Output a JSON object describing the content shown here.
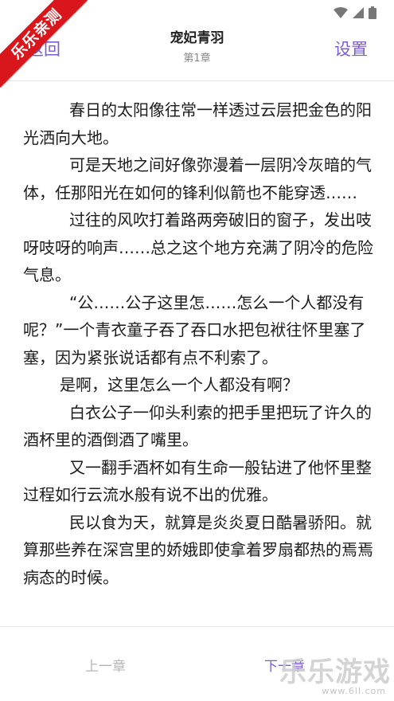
{
  "header": {
    "back_label": "返回",
    "book_title": "宠妃青羽",
    "chapter": "第1章",
    "settings_label": "设置"
  },
  "ribbon_text": "乐乐亲测",
  "content": {
    "paragraphs": [
      "春日的太阳像往常一样透过云层把金色的阳光洒向大地。",
      "可是天地之间好像弥漫着一层阴冷灰暗的气体，任那阳光在如何的锋利似箭也不能穿透……",
      "过往的风吹打着路两旁破旧的窗子，发出吱呀吱呀的响声……总之这个地方充满了阴冷的危险气息。",
      "“公……公子这里怎……怎么一个人都没有呢？”一个青衣童子吞了吞口水把包袱往怀里塞了塞，因为紧张说话都有点不利索了。",
      "是啊，这里怎么一个人都没有啊？",
      "白衣公子一仰头利索的把手里把玩了许久的酒杯里的酒倒酒了嘴里。",
      "又一翻手酒杯如有生命一般钻进了他怀里整过程如行云流水般有说不出的优雅。",
      "民以食为天，就算是炎炎夏日酷暑骄阳。就算那些养在深宫里的娇娥即使拿着罗扇都热的焉焉病态的时候。"
    ]
  },
  "footer": {
    "prev_label": "上一章",
    "next_label": "下一章"
  },
  "watermark": {
    "text": "乐乐游戏",
    "url": "www.6ll.com"
  },
  "status": {
    "icons": [
      "wifi-icon",
      "signal-icon",
      "battery-icon"
    ]
  },
  "colors": {
    "accent": "#7c5ccf",
    "ribbon": "#d8161c",
    "disabled": "#b5b5b5",
    "text": "#1c1c1c"
  }
}
